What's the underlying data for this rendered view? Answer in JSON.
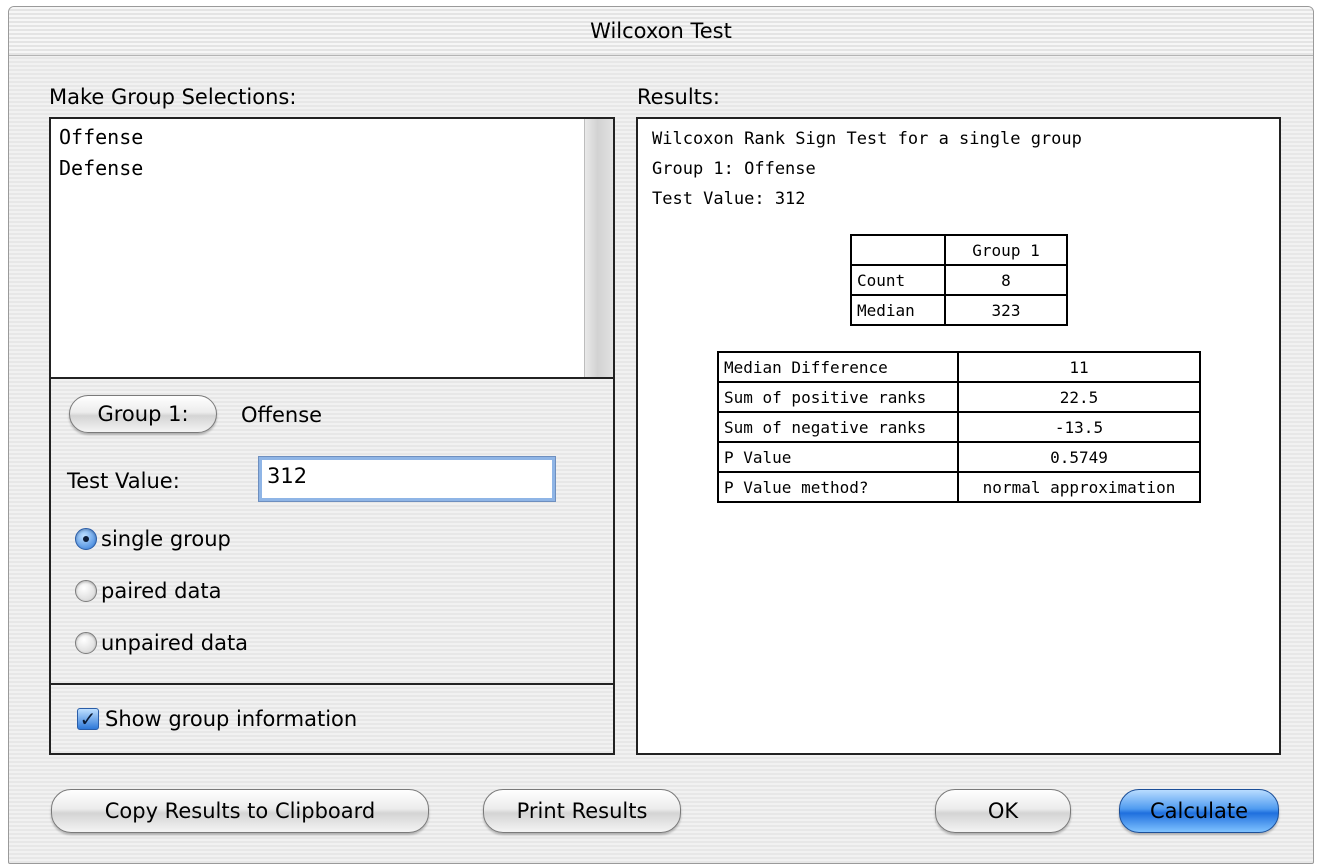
{
  "window": {
    "title": "Wilcoxon Test"
  },
  "groups": {
    "label": "Make Group Selections:",
    "items": [
      "Offense",
      "Defense"
    ]
  },
  "controls": {
    "group1_button": "Group 1:",
    "group1_value": "Offense",
    "test_value_label": "Test Value:",
    "test_value": "312",
    "radios": [
      {
        "label": "single group",
        "selected": true
      },
      {
        "label": "paired data",
        "selected": false
      },
      {
        "label": "unpaired data",
        "selected": false
      }
    ],
    "show_group_info": {
      "label": "Show group information",
      "checked": true
    }
  },
  "results": {
    "label": "Results:",
    "lines": [
      "Wilcoxon Rank Sign Test for a single group",
      "Group 1: Offense",
      "Test Value: 312"
    ],
    "summary_table": {
      "header": [
        "",
        "Group 1"
      ],
      "rows": [
        [
          "Count",
          "8"
        ],
        [
          "Median",
          "323"
        ]
      ]
    },
    "stats_table": {
      "rows": [
        [
          "Median Difference",
          "11"
        ],
        [
          "Sum of positive ranks",
          "22.5"
        ],
        [
          "Sum of negative ranks",
          "-13.5"
        ],
        [
          "P Value",
          "0.5749"
        ],
        [
          "P Value method?",
          "normal approximation"
        ]
      ]
    }
  },
  "buttons": {
    "copy": "Copy Results to Clipboard",
    "print": "Print Results",
    "ok": "OK",
    "calculate": "Calculate"
  },
  "colors": {
    "default_button": "#2d78d8",
    "focus_ring": "#8fb5e6"
  }
}
